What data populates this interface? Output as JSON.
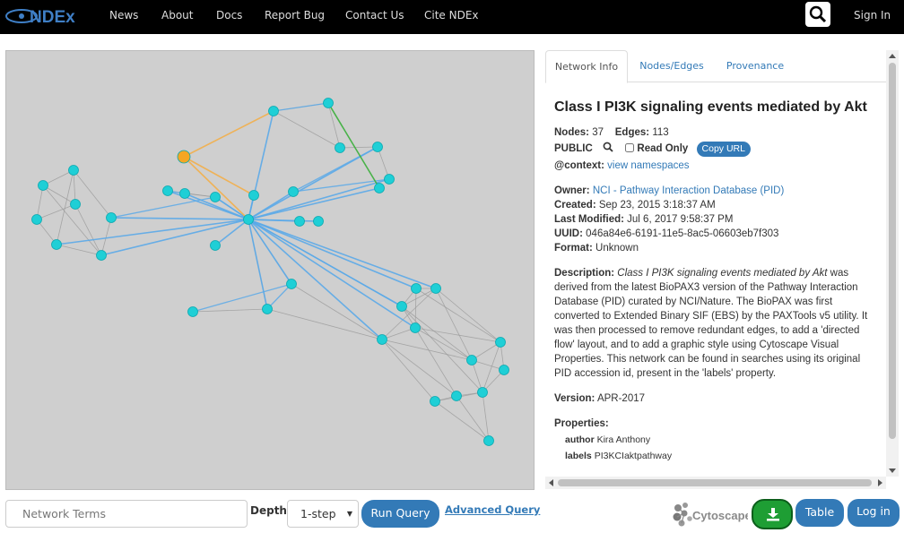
{
  "navbar": {
    "brand": "NDEx",
    "links": [
      "News",
      "About",
      "Docs",
      "Report Bug",
      "Contact Us",
      "Cite NDEx"
    ],
    "signin": "Sign In"
  },
  "tabs": [
    "Network Info",
    "Nodes/Edges",
    "Provenance"
  ],
  "info": {
    "title": "Class I PI3K signaling events mediated by Akt",
    "nodes_label": "Nodes:",
    "nodes": "37",
    "edges_label": "Edges:",
    "edges": "113",
    "visibility": "PUBLIC",
    "readonly_label": "Read Only",
    "copy_url": "Copy URL",
    "context_label": "@context:",
    "context_link": "view namespaces",
    "owner_label": "Owner:",
    "owner": "NCI - Pathway Interaction Database (PID)",
    "created_label": "Created:",
    "created": "Sep 23, 2015 3:18:37 AM",
    "modified_label": "Last Modified:",
    "modified": "Jul 6, 2017 9:58:37 PM",
    "uuid_label": "UUID:",
    "uuid": "046a84e6-6191-11e5-8ac5-06603eb7f303",
    "format_label": "Format:",
    "format": "Unknown",
    "description_label": "Description:",
    "description_em": "Class I PI3K signaling events mediated by Akt",
    "description_rest": " was derived from the latest BioPAX3 version of the Pathway Interaction Database (PID) curated by NCI/Nature. The BioPAX was first converted to Extended Binary SIF (EBS) by the PAXTools v5 utility. It was then processed to remove redundant edges, to add a 'directed flow' layout, and to add a graphic style using Cytoscape Visual Properties. This network can be found in searches using its original PID accession id, present in the 'labels' property.",
    "version_label": "Version:",
    "version": "APR-2017",
    "properties_label": "Properties:",
    "properties": [
      {
        "key": "author",
        "value": "Kira Anthony"
      },
      {
        "key": "labels",
        "value": "PI3KCIaktpathway"
      }
    ]
  },
  "query": {
    "terms_placeholder": "Network Terms",
    "depth_label": "Depth:",
    "depth_value": "1-step",
    "run": "Run Query",
    "advanced": "Advanced Query"
  },
  "footer": {
    "cytoscape": "Cytoscape",
    "table": "Table",
    "login": "Log in"
  },
  "colors": {
    "node": "#1fcfd6",
    "node_highlight": "#f5a623",
    "edge_blue": "#5aa9e8",
    "edge_orange": "#f0b050",
    "edge_green": "#40b040",
    "edge_gray": "#9a9a9a",
    "accent": "#337ab7",
    "download": "#1e9e34"
  },
  "icons": [
    "search-icon",
    "magnifier-icon",
    "download-icon",
    "cytoscape-logo"
  ]
}
